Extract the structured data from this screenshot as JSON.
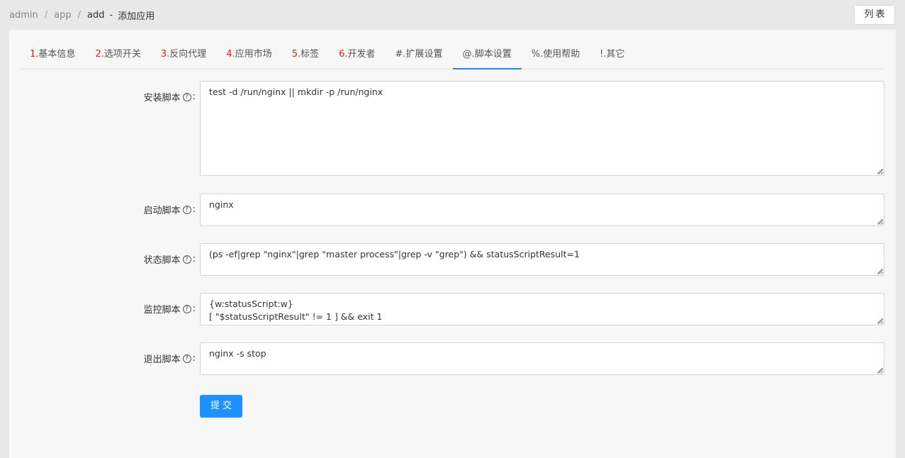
{
  "breadcrumb": {
    "items": [
      "admin",
      "app",
      "add"
    ],
    "dash": "-",
    "title": "添加应用"
  },
  "header": {
    "list_button": "列表"
  },
  "tabs": [
    {
      "num": "1.",
      "label": "基本信息",
      "num_color": "#e02020"
    },
    {
      "num": "2.",
      "label": "选项开关",
      "num_color": "#e02020"
    },
    {
      "num": "3.",
      "label": "反向代理",
      "num_color": "#e02020"
    },
    {
      "num": "4.",
      "label": "应用市场",
      "num_color": "#e02020"
    },
    {
      "num": "5.",
      "label": "标签",
      "num_color": "#e02020"
    },
    {
      "num": "6.",
      "label": "开发者",
      "num_color": "#e02020"
    },
    {
      "num": "",
      "label": "#.扩展设置"
    },
    {
      "num": "",
      "label": "@.脚本设置",
      "active": true
    },
    {
      "num": "",
      "label": "%.使用帮助"
    },
    {
      "num": "",
      "label": "!.其它"
    }
  ],
  "form": {
    "install": {
      "label": "安装脚本",
      "value": "test -d /run/nginx || mkdir -p /run/nginx"
    },
    "start": {
      "label": "启动脚本",
      "value": "nginx"
    },
    "status": {
      "label": "状态脚本",
      "value": "(ps -ef|grep \"nginx\"|grep \"master process\"|grep -v \"grep\") && statusScriptResult=1"
    },
    "monitor": {
      "label": "监控脚本",
      "value": "{w:statusScript:w}\n[ \"$statusScriptResult\" != 1 ] && exit 1"
    },
    "exit": {
      "label": "退出脚本",
      "value": "nginx -s stop"
    },
    "help_glyph": "?",
    "colon": ":"
  },
  "submit_label": "提交",
  "colors": {
    "accent": "#1e90ff",
    "tab_number": "#e02020",
    "active_underline": "#1e88e5"
  }
}
